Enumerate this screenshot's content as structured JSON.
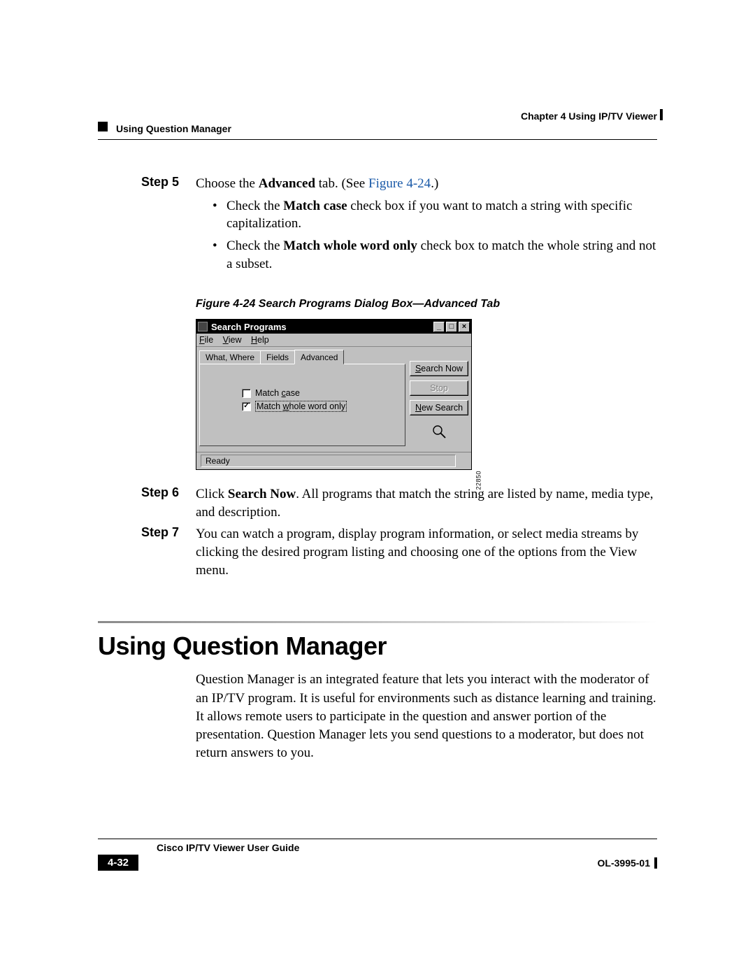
{
  "header": {
    "chapter_line": "Chapter 4      Using IP/TV Viewer",
    "section_line": "Using Question Manager"
  },
  "steps": {
    "s5": {
      "label": "Step 5",
      "lead_pre": "Choose the ",
      "lead_bold": "Advanced",
      "lead_post": " tab. (See ",
      "fig_ref": "Figure 4-24",
      "lead_end": ".)",
      "b1_pre": "Check the ",
      "b1_bold": "Match case",
      "b1_post": " check box if you want to match a string with specific capitalization.",
      "b2_pre": "Check the ",
      "b2_bold": "Match whole word only",
      "b2_post": " check box to match the whole string and not a subset."
    },
    "s6": {
      "label": "Step 6",
      "pre": "Click ",
      "bold": "Search Now",
      "post": ". All programs that match the string are listed by name, media type, and description."
    },
    "s7": {
      "label": "Step 7",
      "text": "You can watch a program, display program information, or select media streams by clicking the desired program listing and choosing one of the options from the View menu."
    }
  },
  "figure": {
    "caption": "Figure 4-24   Search Programs Dialog Box—Advanced Tab",
    "id_label": "22850",
    "dialog": {
      "title": "Search Programs",
      "menu_file": "File",
      "menu_view": "View",
      "menu_help": "Help",
      "tab1": "What, Where",
      "tab2": "Fields",
      "tab3": "Advanced",
      "chk1": "Match case",
      "chk2": "Match whole word only",
      "btn_search": "Search Now",
      "btn_stop": "Stop",
      "btn_new": "New Search",
      "status": "Ready"
    }
  },
  "section": {
    "heading": "Using Question Manager",
    "para": "Question Manager is an integrated feature that lets you interact with the moderator of an IP/TV program. It is useful for environments such as distance learning and training. It allows remote users to participate in the question and answer portion of the presentation. Question Manager lets you send questions to a moderator, but does not return answers to you."
  },
  "footer": {
    "guide": "Cisco IP/TV Viewer User Guide",
    "page": "4-32",
    "doc": "OL-3995-01"
  }
}
